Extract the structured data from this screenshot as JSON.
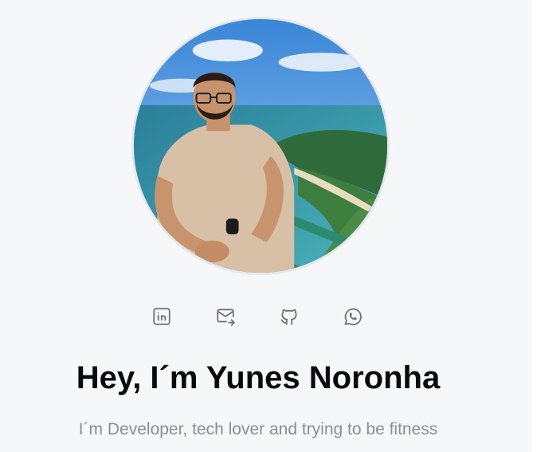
{
  "profile": {
    "name_heading": "Hey, I´m Yunes Noronha",
    "tagline": "I´m Developer, tech lover and trying to be fitness"
  },
  "social_links": [
    {
      "icon": "linkedin-icon"
    },
    {
      "icon": "mail-send-icon"
    },
    {
      "icon": "github-icon"
    },
    {
      "icon": "whatsapp-icon"
    }
  ],
  "colors": {
    "background": "#f6f7f9",
    "heading": "#0b0b0f",
    "subtitle": "#8b8e96",
    "icon": "#6b6f78"
  }
}
